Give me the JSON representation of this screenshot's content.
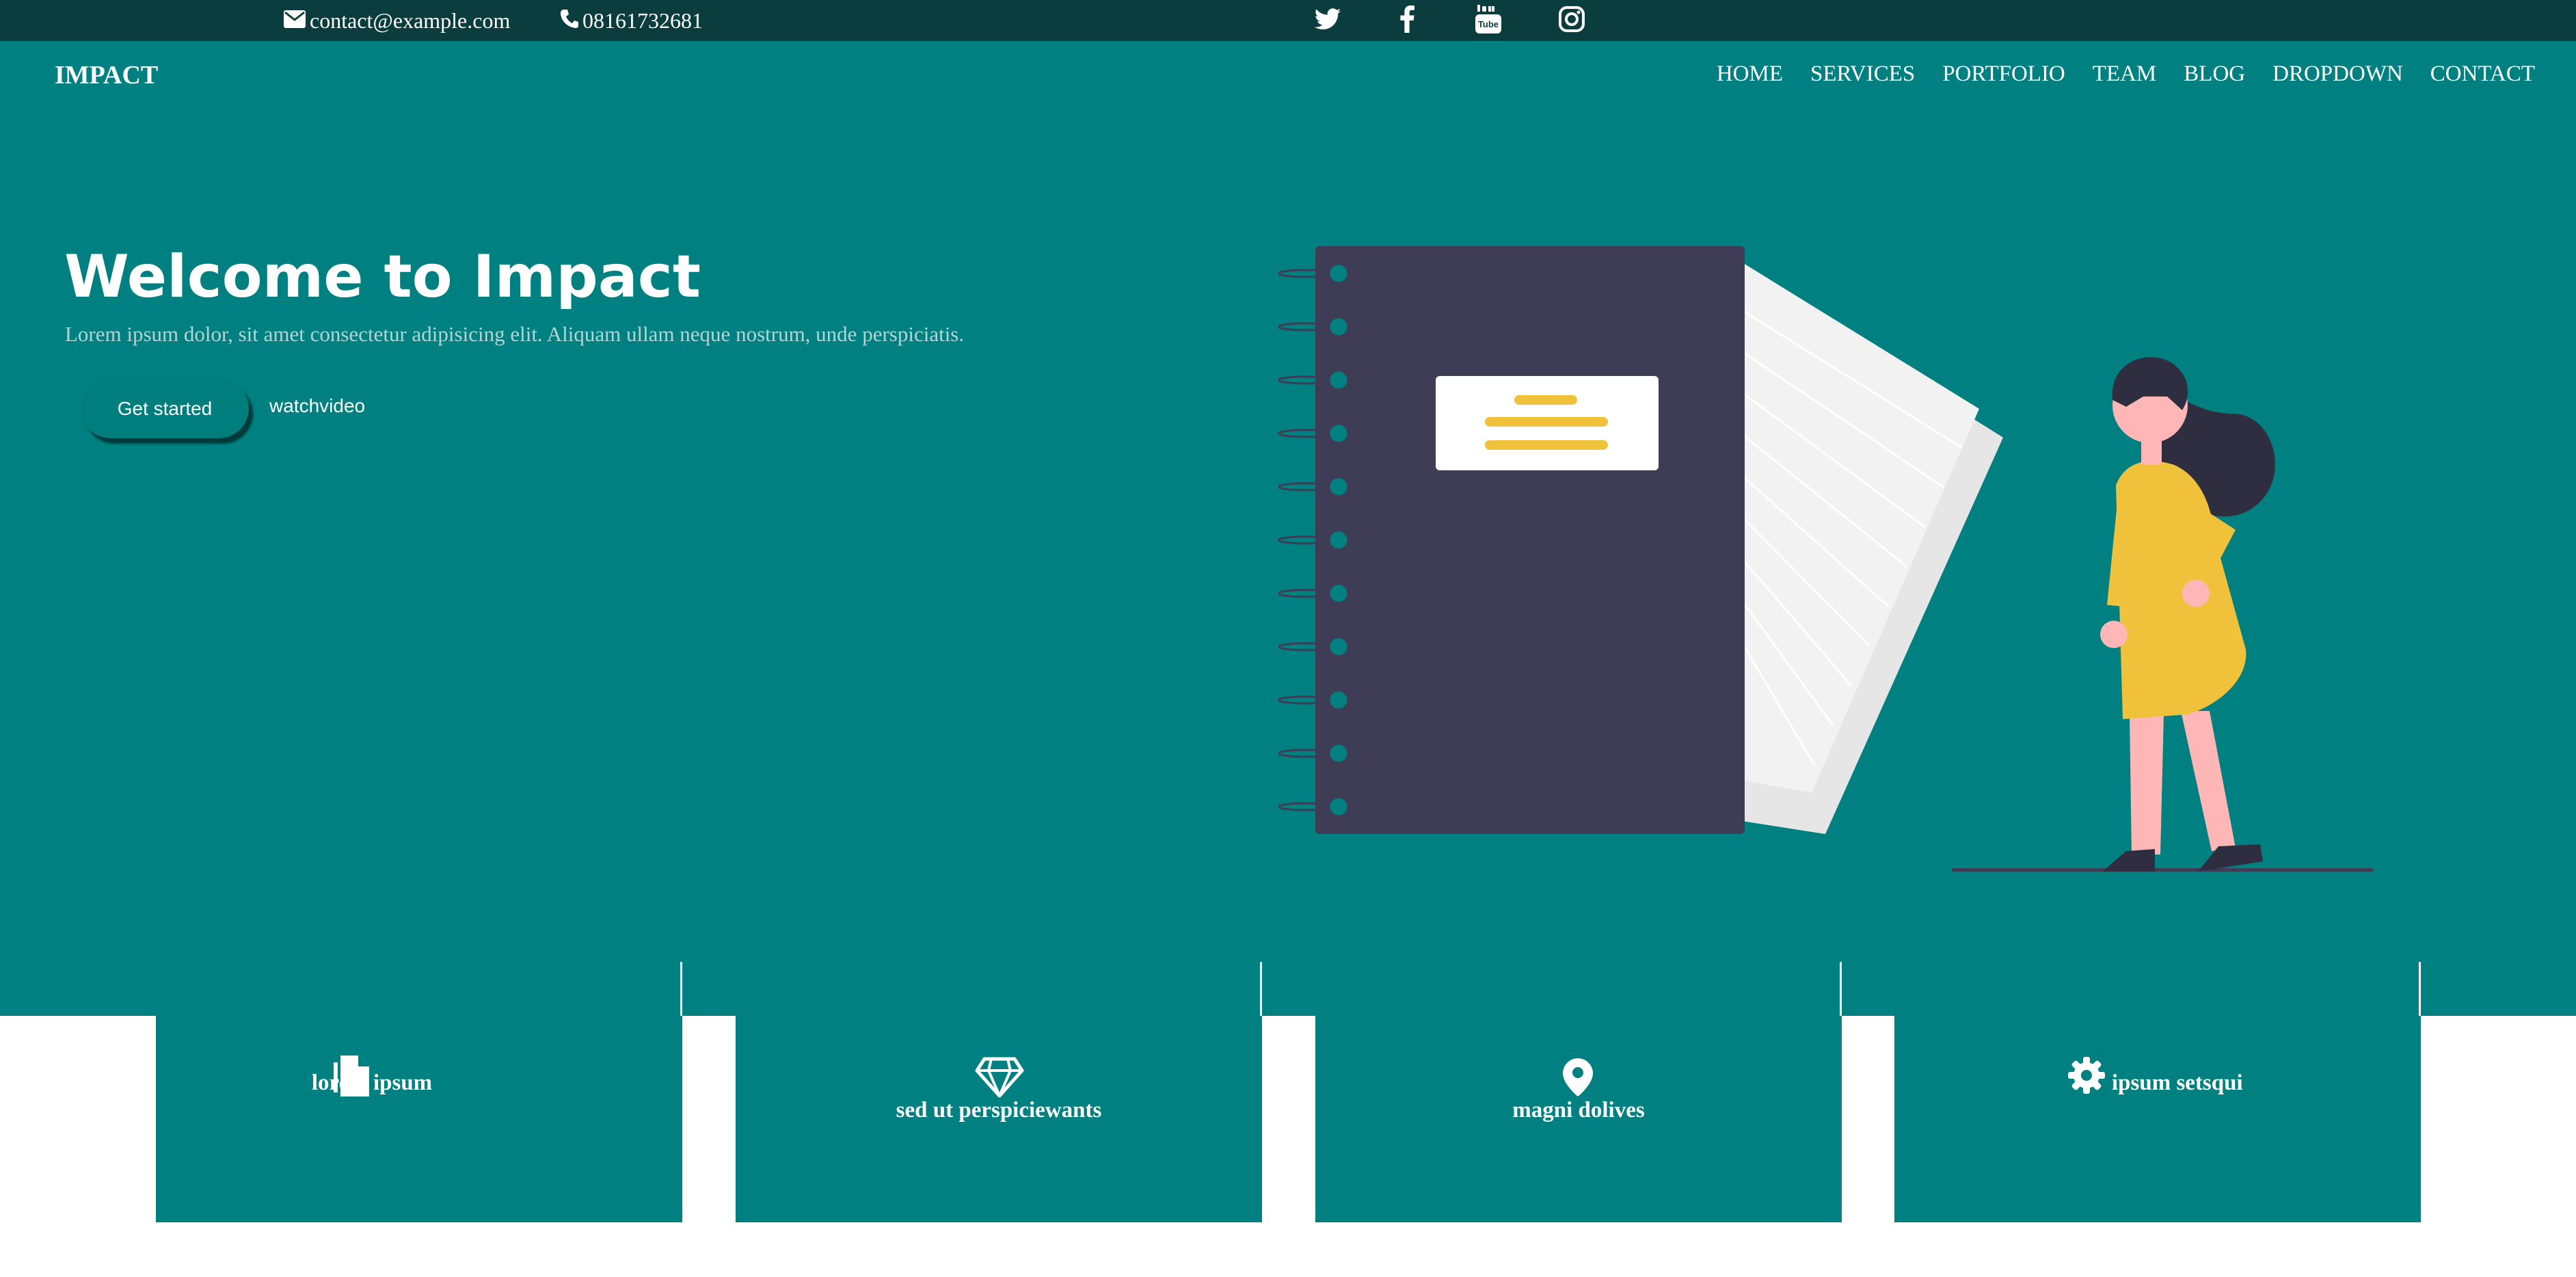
{
  "topbar": {
    "email": "contact@example.com",
    "phone": "08161732681",
    "social_icons": [
      "twitter-icon",
      "facebook-icon",
      "youtube-icon",
      "instagram-icon"
    ]
  },
  "brand": {
    "logo": "IMPACT"
  },
  "nav": {
    "items": [
      "HOME",
      "SERVICES",
      "PORTFOLIO",
      "TEAM",
      "BLOG",
      "DROPDOWN",
      "CONTACT"
    ]
  },
  "hero": {
    "title": "Welcome to Impact",
    "subtitle": "Lorem ipsum dolor, sit amet consectetur adipisicing elit. Aliquam ullam neque nostrum, unde perspiciatis.",
    "primary_button": "Get started",
    "secondary_link": "watchvideo",
    "illustration": "notebook-and-woman-illustration"
  },
  "cards": [
    {
      "title": "lorem ipsum",
      "icon": "document-icon"
    },
    {
      "title": "sed ut perspiciewants",
      "icon": "diamond-icon"
    },
    {
      "title": "magni dolives",
      "icon": "map-pin-icon"
    },
    {
      "title": "ipsum setsqui",
      "icon": "gear-icon"
    }
  ],
  "colors": {
    "topbar": "#0c3d3e",
    "primary": "#008080",
    "notebook": "#3f3d56",
    "accent_yellow": "#f0c13b",
    "skin": "#ffb6b6"
  }
}
